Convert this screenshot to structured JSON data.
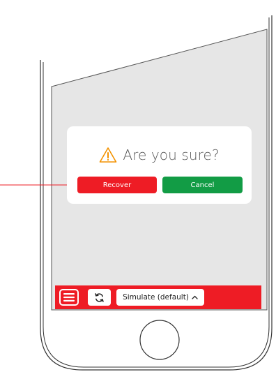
{
  "dialog": {
    "title": "Are you sure?",
    "icon": "warning-icon",
    "recover_label": "Recover",
    "cancel_label": "Cancel"
  },
  "toolbar": {
    "menu_icon": "menu-icon",
    "refresh_icon": "refresh-icon",
    "simulate_label": "Simulate (default)",
    "simulate_icon": "chevron-up-icon"
  },
  "colors": {
    "accent_red": "#ee1c25",
    "confirm_green": "#129c45",
    "screen_gray": "#e6e6e6",
    "warning_orange": "#f39200"
  }
}
